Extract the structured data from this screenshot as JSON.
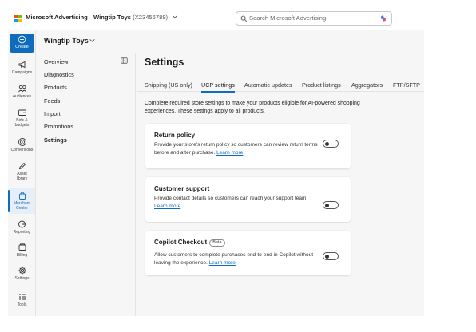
{
  "topbar": {
    "brand": "Microsoft Advertising",
    "account_name": "Wingtip Toys",
    "account_id": "(X23456789)",
    "search_placeholder": "Search Microsoft Advertising"
  },
  "rail": {
    "create": "Create",
    "items": [
      {
        "label": "Campaigns",
        "icon": "megaphone-icon"
      },
      {
        "label": "Audiences",
        "icon": "people-icon"
      },
      {
        "label": "Bids & budgets",
        "icon": "wallet-icon"
      },
      {
        "label": "Conversions",
        "icon": "target-icon"
      },
      {
        "label": "Asset library",
        "icon": "pen-icon"
      },
      {
        "label": "Merchant Center",
        "icon": "shopping-bag-icon"
      },
      {
        "label": "Reporting",
        "icon": "chart-icon"
      },
      {
        "label": "Billing",
        "icon": "billing-icon"
      },
      {
        "label": "Settings",
        "icon": "gear-icon"
      },
      {
        "label": "Tools",
        "icon": "tools-icon"
      }
    ],
    "active": "Merchant Center"
  },
  "panel": {
    "title": "Wingtip Toys",
    "items": [
      "Overview",
      "Diagnostics",
      "Products",
      "Feeds",
      "Import",
      "Promotions",
      "Settings"
    ],
    "active": "Settings"
  },
  "main": {
    "title": "Settings",
    "tabs": [
      "Shipping (US only)",
      "UCP settings",
      "Automatic updates",
      "Product listings",
      "Aggregators",
      "FTP/SFTP"
    ],
    "active_tab": "UCP settings",
    "intro": "Complete required store settings to make your products eligible for AI-powered shopping experiences. These settings apply to all products.",
    "cards": [
      {
        "title": "Return policy",
        "badge": "",
        "desc": "Provide your store's return policy so customers can review return terms before and after purchase.",
        "link": "Learn more",
        "enabled": false
      },
      {
        "title": "Customer support",
        "badge": "",
        "desc": "Provide contact details so customers can reach your support team.",
        "link": "Learn more",
        "enabled": false
      },
      {
        "title": "Copilot Checkout",
        "badge": "Beta",
        "desc": "Allow customers to complete purchases end-to-end in Copilot without leaving the experience.",
        "link": "Learn more",
        "enabled": false
      }
    ]
  },
  "colors": {
    "accent": "#0f6cbd",
    "logo": [
      "#f25022",
      "#7fba00",
      "#00a4ef",
      "#ffb900"
    ]
  }
}
